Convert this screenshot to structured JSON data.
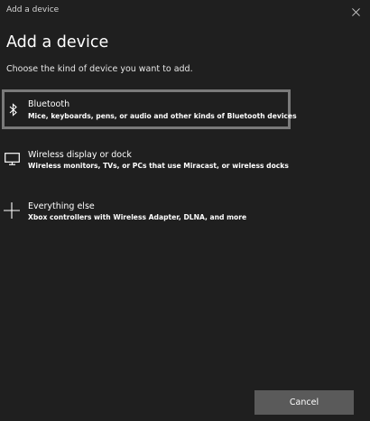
{
  "window": {
    "title": "Add a device"
  },
  "page": {
    "heading": "Add a device",
    "subtitle": "Choose the kind of device you want to add."
  },
  "options": [
    {
      "title": "Bluetooth",
      "description": "Mice, keyboards, pens, or audio and other kinds of Bluetooth devices",
      "icon": "bluetooth-icon",
      "selected": true
    },
    {
      "title": "Wireless display or dock",
      "description": "Wireless monitors, TVs, or PCs that use Miracast, or wireless docks",
      "icon": "monitor-icon",
      "selected": false
    },
    {
      "title": "Everything else",
      "description": "Xbox controllers with Wireless Adapter, DLNA, and more",
      "icon": "plus-icon",
      "selected": false
    }
  ],
  "footer": {
    "cancel_label": "Cancel"
  },
  "colors": {
    "background": "#1f1f1f",
    "selection_border": "#7a7a7a",
    "button": "#5a5a5a"
  }
}
